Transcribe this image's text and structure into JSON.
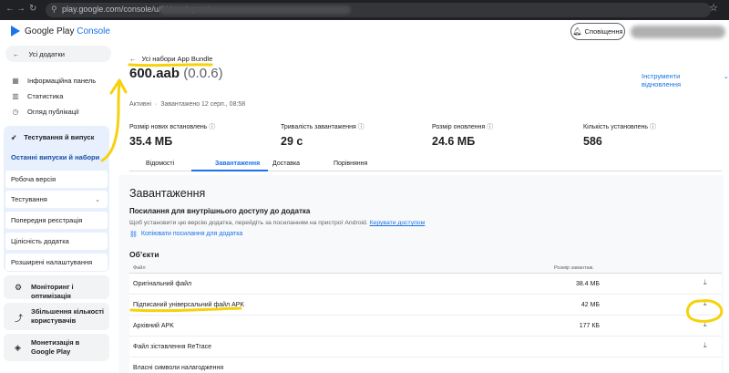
{
  "browser": {
    "url": "play.google.com/console/u/0/developers/"
  },
  "header": {
    "brand": "Google Play",
    "brand_accent": "Console",
    "notifications_label": "Сповіщення"
  },
  "sidebar": {
    "back_label": "Усі додатки",
    "items": [
      {
        "label": "Інформаційна панель",
        "icon": "dashboard-icon"
      },
      {
        "label": "Статистика",
        "icon": "bar-chart-icon"
      },
      {
        "label": "Огляд публікації",
        "icon": "clock-icon"
      }
    ],
    "testing_section": {
      "label": "Тестування й випуск",
      "sub_items": [
        "Останні випуски й набори",
        "Робоча версія",
        "Тестування",
        "Попередня реєстрація",
        "Цілісність додатка",
        "Розширені налаштування"
      ]
    },
    "other_sections": [
      "Моніторинг і оптимізація",
      "Збільшення кількості користувачів",
      "Монетизація в Google Play"
    ]
  },
  "main": {
    "back_label": "Усі набори App Bundle",
    "title": "600.aab",
    "version": "(0.0.6)",
    "tools_label": "Інструменти відновлення",
    "status": "Активні",
    "uploaded": "Завантажено 12 серп., 08:58",
    "stats": [
      {
        "label": "Розмір нових встановлень",
        "value": "35.4 МБ"
      },
      {
        "label": "Тривалість завантаження",
        "value": "29 с"
      },
      {
        "label": "Розмір оновлення",
        "value": "24.6 МБ"
      },
      {
        "label": "Кількість установлень",
        "value": "586"
      }
    ],
    "tabs": [
      "Відомості",
      "Завантаження",
      "Доставка",
      "Порівняння"
    ],
    "active_tab": 1,
    "section_title": "Завантаження",
    "internal_link_title": "Посилання для внутрішнього доступу до додатка",
    "internal_link_desc": "Щоб установити цю версію додатка, перейдіть за посиланням на пристрої Android.",
    "manage_access": "Керувати доступом",
    "copy_link": "Копіювати посилання для додатка",
    "objects_title": "Об’єкти",
    "table_headers": {
      "file": "Файл",
      "size": "Розмір завантаж."
    },
    "files": [
      {
        "name": "Оригінальний файл",
        "size": "38.4 МБ"
      },
      {
        "name": "Підписаний універсальний файл APK",
        "size": "42 МБ"
      },
      {
        "name": "Архівний APK",
        "size": "177 КБ"
      },
      {
        "name": "Файл зіставлення ReTrace",
        "size": ""
      },
      {
        "name": "Власні символи налагодження",
        "size": ""
      }
    ]
  },
  "colors": {
    "accent": "#1a73e8",
    "annotation": "#f5d20c"
  }
}
